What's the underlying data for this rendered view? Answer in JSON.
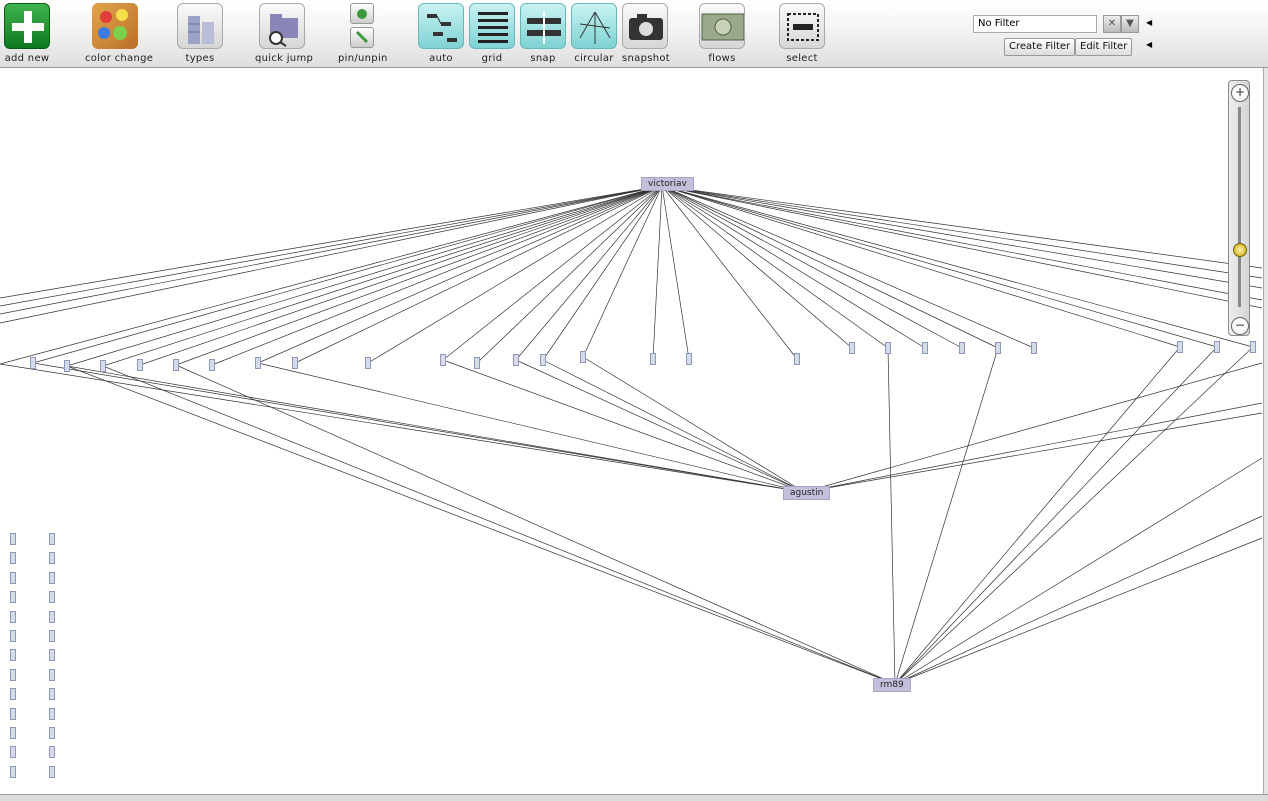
{
  "toolbar": {
    "add_new": "add new",
    "color_change": "color change",
    "types": "types",
    "quick_jump": "quick jump",
    "pin_unpin": "pin/unpin",
    "auto": "auto",
    "grid": "grid",
    "snap": "snap",
    "circular": "circular",
    "snapshot": "snapshot",
    "flows": "flows",
    "select": "select"
  },
  "filter": {
    "value": "No Filter",
    "create_label": "Create Filter",
    "edit_label": "Edit Filter"
  },
  "nodes": {
    "victoriav": "victoriav",
    "agustin": "agustin",
    "rm89": "rm89"
  },
  "colors": {
    "node_fill": "#c4c0dc",
    "edge": "#333333",
    "leaf_fill": "#d5dbe8"
  }
}
